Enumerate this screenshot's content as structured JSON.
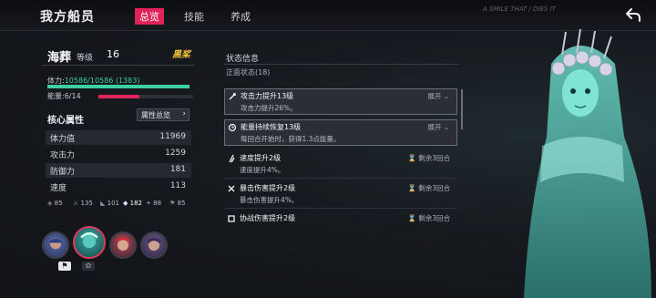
{
  "header": {
    "title": "我方船员",
    "tabs": [
      "总览",
      "技能",
      "养成"
    ],
    "active_tab": 0,
    "deco_text": "A SMILE THAT / DIES IT"
  },
  "character": {
    "name": "海葬",
    "level_label": "等级",
    "level": "16",
    "badge": "黑桨",
    "hp_label": "体力:",
    "hp_value": "10586/10586 (1383)",
    "hp_fraction": 1.0,
    "energy_label": "能量:6/14",
    "energy_fraction": 0.43
  },
  "core": {
    "title": "核心属性",
    "button_label": "属性总览",
    "stats": [
      {
        "name": "体力值",
        "value": "11969"
      },
      {
        "name": "攻击力",
        "value": "1259"
      },
      {
        "name": "防御力",
        "value": "181"
      },
      {
        "name": "速度",
        "value": "113"
      }
    ],
    "mini_stats": [
      "85",
      "135",
      "101",
      "182",
      "88",
      "85"
    ]
  },
  "status": {
    "title": "状态信息",
    "subtitle": "正面状态(18)",
    "expand_label": "展开",
    "buffs": [
      {
        "name": "攻击力提升13级",
        "desc": "攻击力提升26%。",
        "right": "展开",
        "stack": "13"
      },
      {
        "name": "能量持续恢复13级",
        "desc": "每回合开始时，获得1.3点能量。",
        "right": "展开",
        "stack": "13"
      },
      {
        "name": "速度提升2级",
        "desc": "速度提升4%。",
        "right": "剩余3回合",
        "stack": "2"
      },
      {
        "name": "暴击伤害提升2级",
        "desc": "暴击伤害提升4%。",
        "right": "剩余3回合",
        "stack": "2"
      },
      {
        "name": "协战伤害提升2级",
        "desc": "",
        "right": "剩余3回合",
        "stack": "2"
      }
    ]
  },
  "colors": {
    "accent": "#e0245a",
    "hp": "#3ed0a2",
    "energy": "#e0245a",
    "badge": "#f2c33b"
  }
}
